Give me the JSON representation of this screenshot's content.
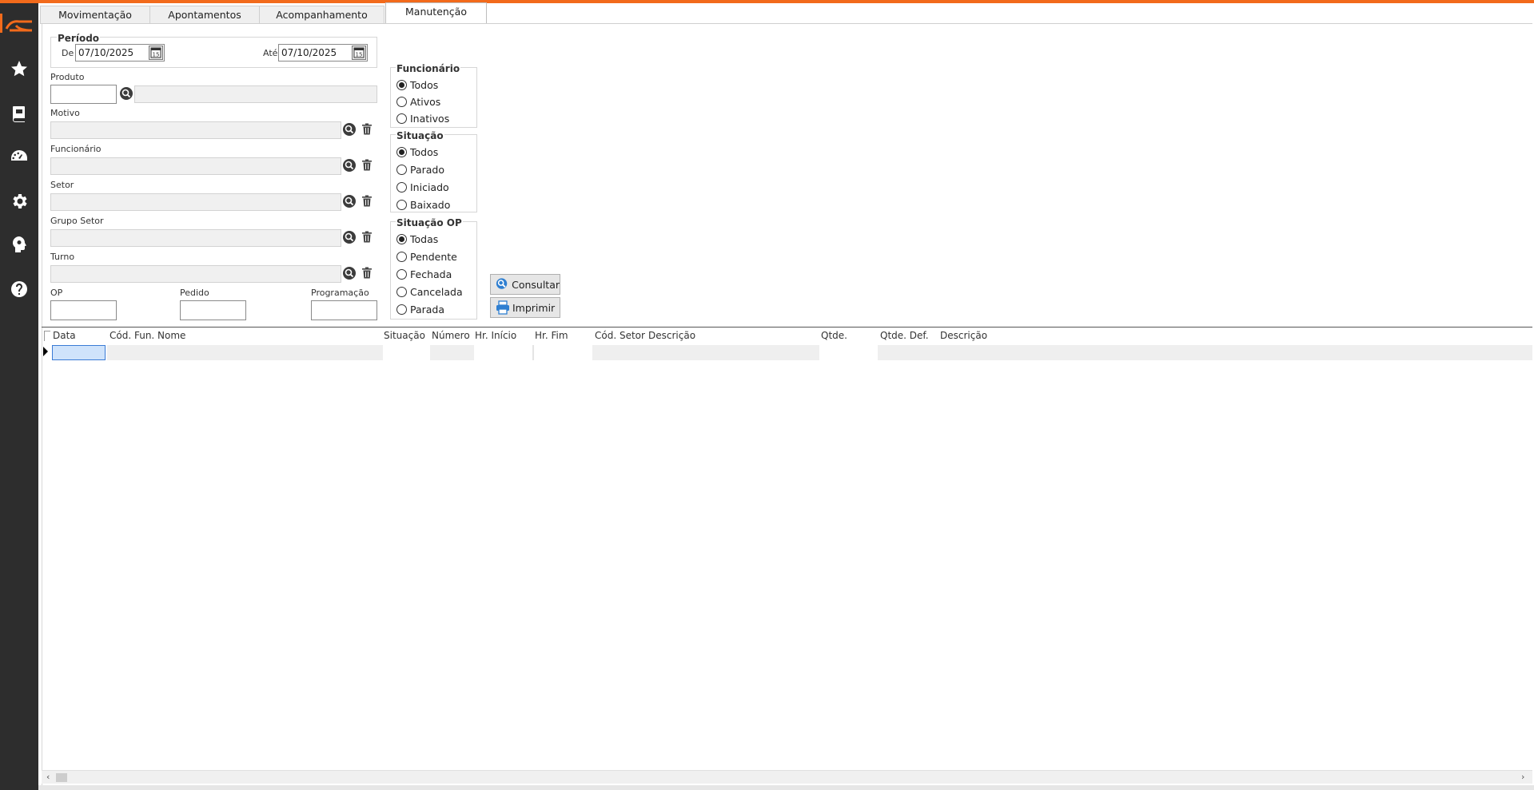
{
  "tabs": [
    "Movimentação",
    "Apontamentos",
    "Acompanhamento",
    "Manutenção"
  ],
  "periodo": {
    "title": "Período",
    "de_label": "De",
    "de_value": "07/10/2025",
    "ate_label": "Até",
    "ate_value": "07/10/2025"
  },
  "labels": {
    "produto": "Produto",
    "motivo": "Motivo",
    "funcionario": "Funcionário",
    "setor": "Setor",
    "grupo_setor": "Grupo Setor",
    "turno": "Turno",
    "op": "OP",
    "pedido": "Pedido",
    "programacao": "Programação"
  },
  "radio_groups": {
    "funcionario": {
      "title": "Funcionário",
      "options": [
        "Todos",
        "Ativos",
        "Inativos"
      ],
      "selected": "Todos"
    },
    "situacao": {
      "title": "Situação",
      "options": [
        "Todos",
        "Parado",
        "Iniciado",
        "Baixado"
      ],
      "selected": "Todos"
    },
    "situacao_op": {
      "title": "Situação OP",
      "options": [
        "Todas",
        "Pendente",
        "Fechada",
        "Cancelada",
        "Parada"
      ],
      "selected": "Todas"
    }
  },
  "buttons": {
    "consultar": "Consultar",
    "imprimir": "Imprimir"
  },
  "grid": {
    "columns": [
      "Data",
      "Cód. Fun.",
      "Nome",
      "Situação",
      "Número",
      "Hr. Início",
      "Hr. Fim",
      "Cód. Setor",
      "Descrição",
      "Qtde.",
      "Qtde. Def.",
      "Descrição"
    ]
  },
  "icons": {
    "sidebar": [
      "logo-icon",
      "star-icon",
      "book-icon",
      "dashboard-icon",
      "gear-icon",
      "head-gear-icon",
      "help-icon"
    ]
  },
  "colors": {
    "accent": "#f26a1b",
    "sidebar": "#2d2d2d"
  }
}
